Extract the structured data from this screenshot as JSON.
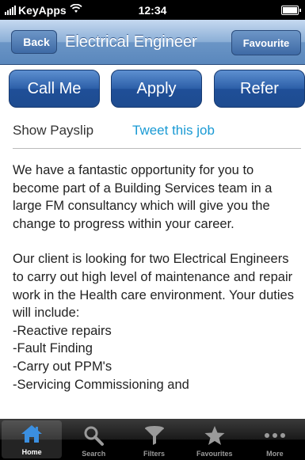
{
  "status_bar": {
    "carrier": "KeyApps",
    "time": "12:34"
  },
  "nav": {
    "back_label": "Back",
    "title": "Electrical Engineer",
    "favourite_label": "Favourite"
  },
  "actions": {
    "call_label": "Call Me",
    "apply_label": "Apply",
    "refer_label": "Refer"
  },
  "links": {
    "payslip_label": "Show Payslip",
    "tweet_label": "Tweet this job"
  },
  "description": {
    "para1": "We have a fantastic opportunity for you to become part of a Building Services team in a large FM consultancy which will give you the change to progress within your career.",
    "para2": "Our client is looking for two Electrical Engineers to carry out high level of maintenance and repair work in the Health care environment. Your duties will include:",
    "items": [
      "-Reactive repairs",
      "-Fault Finding",
      "-Carry out PPM's",
      "-Servicing Commissioning and"
    ]
  },
  "tabs": [
    {
      "label": "Home",
      "icon": "home-icon",
      "active": true
    },
    {
      "label": "Search",
      "icon": "search-icon",
      "active": false
    },
    {
      "label": "Filters",
      "icon": "filter-icon",
      "active": false
    },
    {
      "label": "Favourites",
      "icon": "star-icon",
      "active": false
    },
    {
      "label": "More",
      "icon": "more-icon",
      "active": false
    }
  ],
  "colors": {
    "nav_blue": "#6a95c6",
    "button_blue": "#2c5fa8",
    "link_blue": "#1a9ad4",
    "active_tab_blue": "#3b8fe0"
  }
}
